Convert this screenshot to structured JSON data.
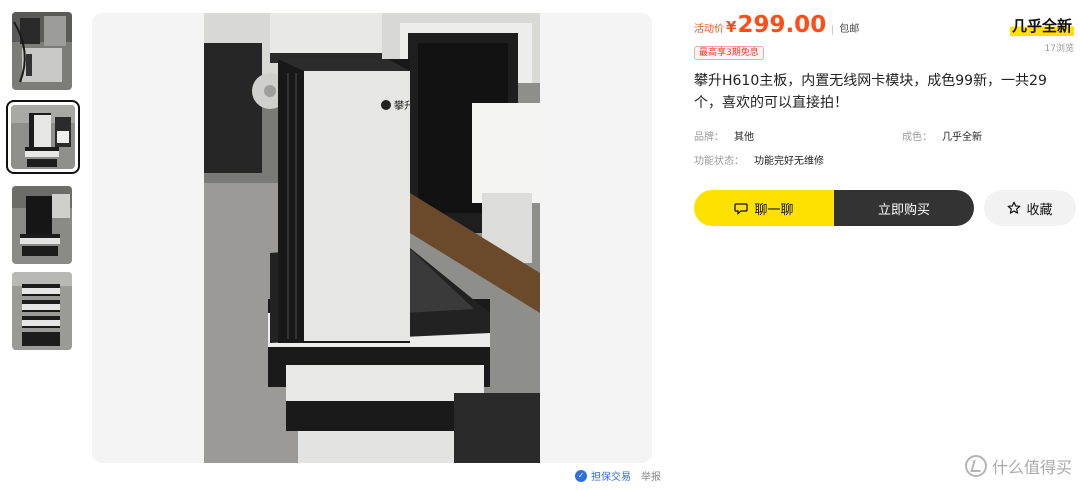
{
  "gallery": {
    "thumbnails": [
      {
        "name": "thumb-1",
        "active": false
      },
      {
        "name": "thumb-2",
        "active": true
      },
      {
        "name": "thumb-3",
        "active": false
      },
      {
        "name": "thumb-4",
        "active": false
      }
    ],
    "main_photo_brand_text": "攀升"
  },
  "stage_footer": {
    "guarantee_icon": "shield-check-icon",
    "guarantee_label": "担保交易",
    "report_label": "举报"
  },
  "product": {
    "price_label": "活动价",
    "currency": "¥",
    "price": "299.00",
    "shipping": "包邮",
    "condition_badge": "几乎全新",
    "promo": "最高享3期免息",
    "views": "17浏览",
    "description": "攀升H610主板，内置无线网卡模块，成色99新，一共29个，喜欢的可以直接拍！",
    "attributes": [
      {
        "key": "品牌：",
        "value": "其他"
      },
      {
        "key": "成色：",
        "value": "几乎全新"
      },
      {
        "key": "功能状态：",
        "value": "功能完好无维修"
      }
    ]
  },
  "actions": {
    "chat_icon": "chat-bubble-icon",
    "chat_label": "聊一聊",
    "buy_label": "立即购买",
    "favorite_icon": "star-icon",
    "favorite_label": "收藏"
  },
  "watermark": {
    "text": "什么值得买"
  },
  "colors": {
    "price": "#ff4d1a",
    "chat_button": "#ffe100",
    "buy_button": "#333333",
    "favorite_button": "#f2f2f2"
  }
}
